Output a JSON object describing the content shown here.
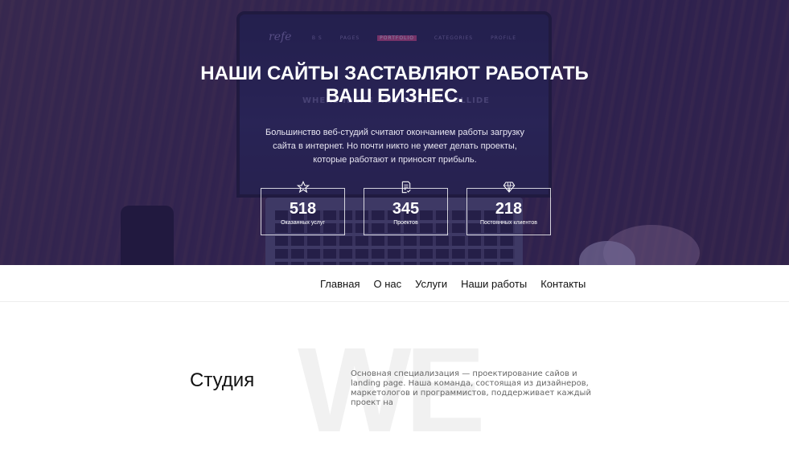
{
  "hero": {
    "title_line1": "НАШИ САЙТЫ ЗАСТАВЛЯЮТ РАБОТАТЬ",
    "title_line2": "ВАШ БИЗНЕС.",
    "description": "Большинство веб-студий считают окончанием работы загрузку сайта в интернет. Но почти никто не умеет делать проекты, которые работают и приносят прибыль.",
    "stats": [
      {
        "icon": "star-icon",
        "value": "518",
        "label": "Оказанных услуг"
      },
      {
        "icon": "document-check-icon",
        "value": "345",
        "label": "Проектов"
      },
      {
        "icon": "diamond-icon",
        "value": "218",
        "label": "Постоянных клиентов"
      }
    ]
  },
  "nav": {
    "items": [
      "Главная",
      "О нас",
      "Услуги",
      "Наши работы",
      "Контакты"
    ]
  },
  "studio": {
    "watermark": "WE",
    "title": "Студия",
    "text": "Основная специализация — проектирование сайов и landing page. Наша команда, состоящая из дизайнеров, маркетологов и программистов, поддерживает каждый проект на"
  }
}
